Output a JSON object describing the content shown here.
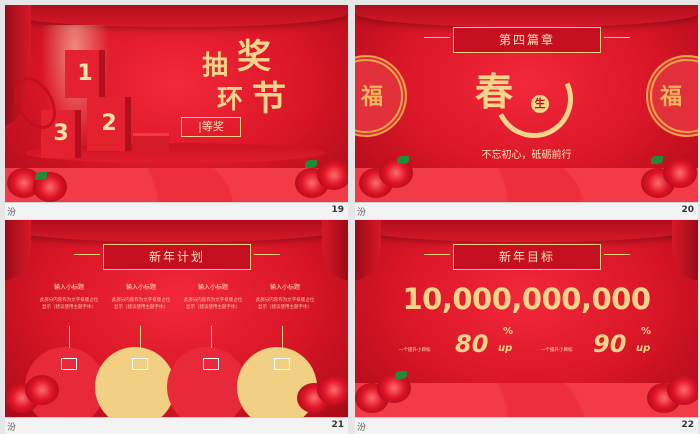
{
  "slides": [
    {
      "number": "19",
      "calligraphy": [
        "抽",
        "奖",
        "环",
        "节"
      ],
      "prize_label": "|等奖",
      "boxes": [
        "1",
        "2",
        "3"
      ]
    },
    {
      "number": "20",
      "chapter_title": "第四篇章",
      "big_char": "春",
      "seal_char": "生",
      "subtitle": "不忘初心，砥砺前行",
      "medallion_char": "福"
    },
    {
      "number": "21",
      "title": "新年计划",
      "items": [
        {
          "heading": "输入小标题",
          "body": "此部分内容作为文字排版占位显示（建议使用主题字体）"
        },
        {
          "heading": "输入小标题",
          "body": "此部分内容作为文字排版占位显示（建议使用主题字体）"
        },
        {
          "heading": "输入小标题",
          "body": "此部分内容作为文字排版占位显示（建议使用主题字体）"
        },
        {
          "heading": "输入小标题",
          "body": "此部分内容作为文字排版占位显示（建议使用主题字体）"
        }
      ]
    },
    {
      "number": "22",
      "title": "新年目标",
      "big_number": "10,000,000,000",
      "stats": [
        {
          "label": "一个提升小目标",
          "value": "80",
          "unit_top": "%",
          "unit_bottom": "up"
        },
        {
          "label": "一个提升小目标",
          "value": "90",
          "unit_top": "%",
          "unit_bottom": "up"
        }
      ]
    }
  ],
  "caption_icon": "汾",
  "colors": {
    "red": "#d81526",
    "gold": "#f6d58a",
    "dark_red": "#a80a18"
  }
}
